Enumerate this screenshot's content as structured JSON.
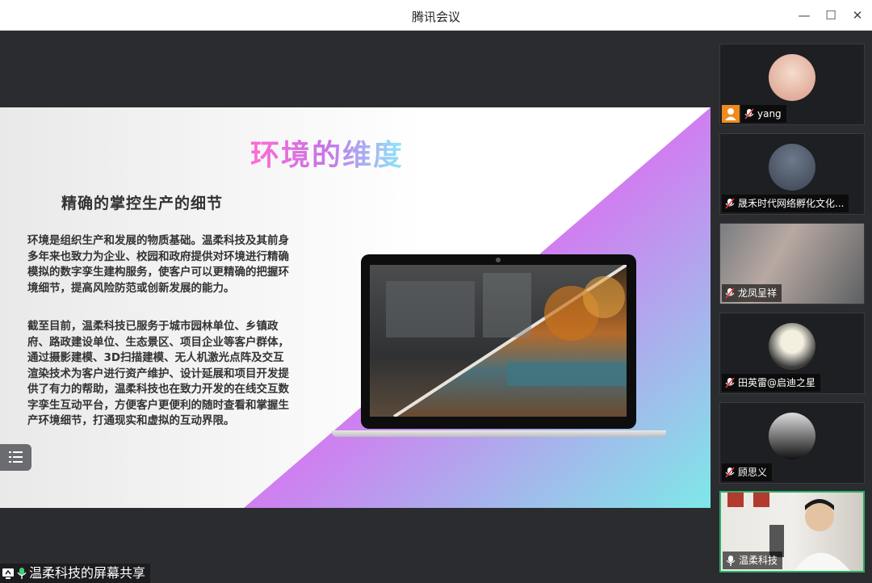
{
  "window": {
    "title": "腾讯会议",
    "minimize_icon": "minimize-icon",
    "maximize_icon": "maximize-icon",
    "close_icon": "close-icon"
  },
  "slide": {
    "title": "环境的维度",
    "subtitle": "精确的掌控生产的细节",
    "paragraph1": "环境是组织生产和发展的物质基础。温柔科技及其前身多年来也致力为企业、校园和政府提供对环境进行精确模拟的数字孪生建构服务，使客户可以更精确的把握环境细节，提高风险防范或创新发展的能力。",
    "paragraph2": "截至目前，温柔科技已服务于城市园林单位、乡镇政府、路政建设单位、生态景区、项目企业等客户群体，通过摄影建模、3D扫描建模、无人机激光点阵及交互渲染技术为客户进行资产维护、设计延展和项目开发提供了有力的帮助，温柔科技也在致力开发的在线交互数字孪生互动平台，方便客户更便利的随时查看和掌握生产环境细节，打通现实和虚拟的互动界限。",
    "accent_colors": [
      "#ff5ad7",
      "#c774e8",
      "#7ee8e8"
    ]
  },
  "share": {
    "label": "温柔科技的屏幕共享"
  },
  "participants": [
    {
      "name": "yang",
      "mic": "muted",
      "host": true
    },
    {
      "name": "晟禾时代网络孵化文化...",
      "mic": "muted",
      "host": false
    },
    {
      "name": "龙凤呈祥",
      "mic": "muted",
      "host": false
    },
    {
      "name": "田英雷@启迪之星",
      "mic": "muted",
      "host": false
    },
    {
      "name": "顾思义",
      "mic": "muted",
      "host": false
    },
    {
      "name": "温柔科技",
      "mic": "on",
      "host": false
    }
  ]
}
